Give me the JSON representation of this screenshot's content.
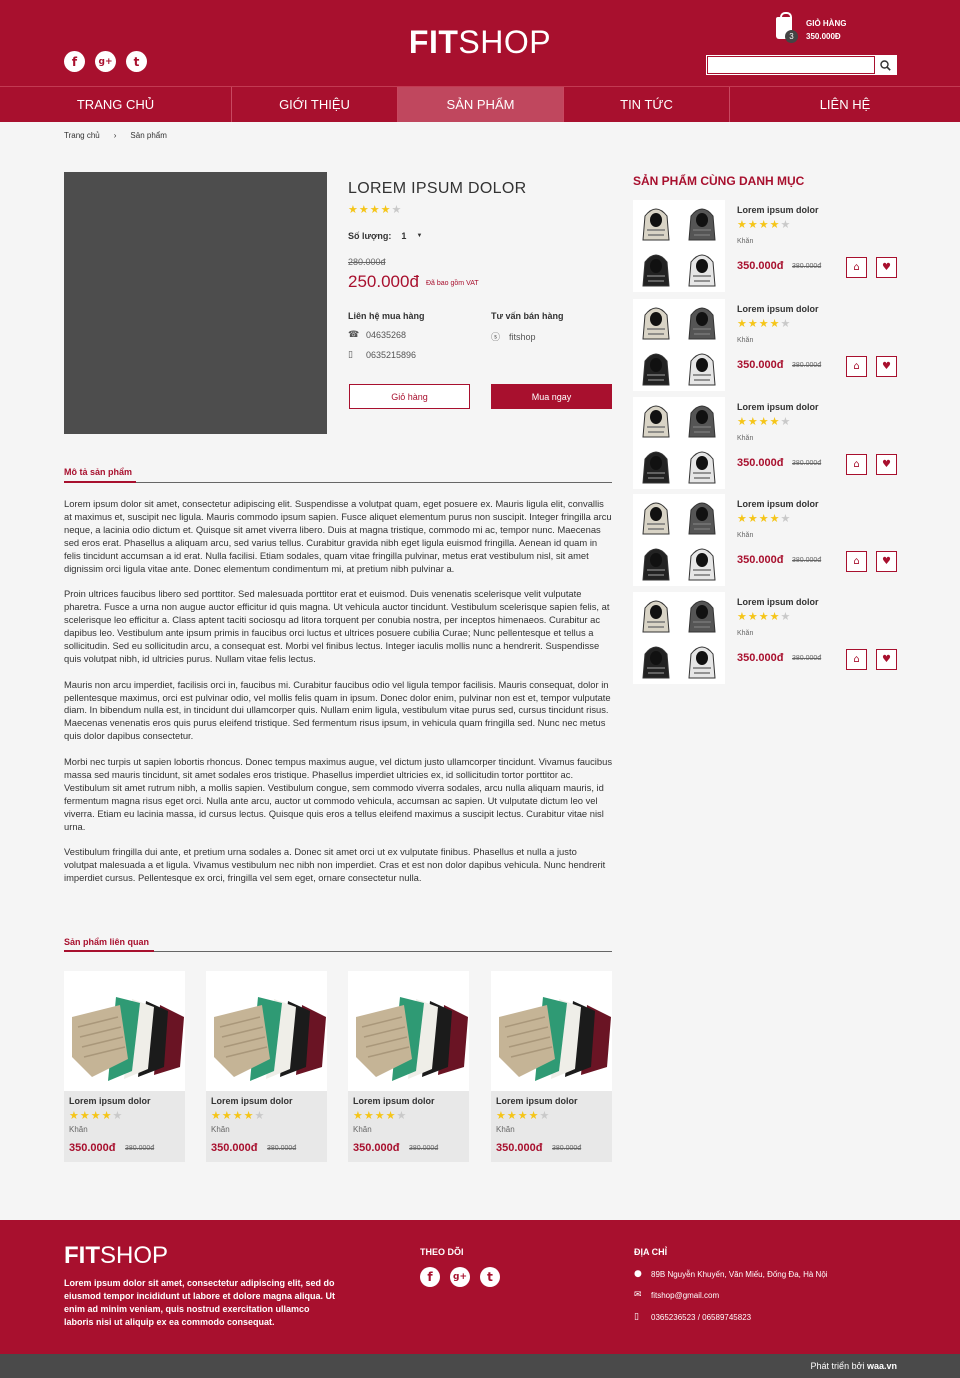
{
  "header": {
    "logo_bold": "FIT",
    "logo_light": "SHOP",
    "cart_label": "GIỎ HÀNG",
    "cart_amount": "350.000Đ",
    "cart_count": "3",
    "search_placeholder": ""
  },
  "nav": {
    "items": [
      {
        "label": "TRANG CHỦ"
      },
      {
        "label": "GIỚI THIỆU"
      },
      {
        "label": "SẢN PHẨM"
      },
      {
        "label": "TIN TỨC"
      },
      {
        "label": "LIÊN HỆ"
      }
    ],
    "active_index": 2
  },
  "breadcrumb": [
    "Trang chủ",
    "›",
    "Sản phẩm"
  ],
  "product": {
    "title": "LOREM IPSUM DOLOR",
    "rating": 4,
    "qty_label": "Số lượng:",
    "qty_value": "1",
    "old_price": "280.000đ",
    "new_price": "250.000đ",
    "vat_note": "Đã bao gồm VAT",
    "contact_heading": "Liên hệ mua hàng",
    "phone1": "04635268",
    "phone2": "0635215896",
    "consult_heading": "Tư vấn bán hàng",
    "skype": "fitshop",
    "cart_button": "Giỏ hàng",
    "buy_button": "Mua ngay"
  },
  "description": {
    "heading": "Mô tả sản phẩm",
    "paragraphs": [
      "Lorem ipsum dolor sit amet, consectetur adipiscing elit. Suspendisse a volutpat quam, eget posuere ex. Mauris ligula elit, convallis at maximus et, suscipit nec ligula. Mauris commodo ipsum sapien. Fusce aliquet elementum purus non suscipit. Integer fringilla arcu neque, a lacinia odio dictum et. Quisque sit amet viverra libero. Duis at magna tristique, commodo mi ac, tempor nunc. Maecenas sed eros erat. Phasellus a aliquam arcu, sed varius tellus. Curabitur gravida nibh eget ligula euismod fringilla. Aenean id quam in felis tincidunt accumsan a id erat. Nulla facilisi. Etiam sodales, quam vitae fringilla pulvinar, metus erat vestibulum nisl, sit amet dignissim orci ligula vitae ante. Donec elementum condimentum mi, at pretium nibh pulvinar a.",
      "Proin ultrices faucibus libero sed porttitor. Sed malesuada porttitor erat et euismod. Duis venenatis scelerisque velit vulputate pharetra. Fusce a urna non augue auctor efficitur id quis magna. Ut vehicula auctor tincidunt. Vestibulum scelerisque sapien felis, at scelerisque leo efficitur a. Class aptent taciti sociosqu ad litora torquent per conubia nostra, per inceptos himenaeos. Curabitur ac dapibus leo. Vestibulum ante ipsum primis in faucibus orci luctus et ultrices posuere cubilia Curae; Nunc pellentesque et tellus a sollicitudin. Sed eu sollicitudin arcu, a consequat est. Morbi vel finibus lectus. Integer iaculis mollis nunc a hendrerit. Suspendisse quis volutpat nibh, id ultricies purus. Nullam vitae felis lectus.",
      "Mauris non arcu imperdiet, facilisis orci in, faucibus mi. Curabitur faucibus odio vel ligula tempor facilisis. Mauris consequat, dolor in pellentesque maximus, orci est pulvinar odio, vel mollis felis quam in ipsum. Donec dolor enim, pulvinar non est et, tempor vulputate diam. In bibendum nulla est, in tincidunt dui ullamcorper quis. Nullam enim ligula, vestibulum vitae purus sed, cursus tincidunt risus. Maecenas venenatis eros quis purus eleifend tristique. Sed fermentum risus ipsum, in vehicula quam fringilla sed. Nunc nec metus quis dolor dapibus consectetur.",
      "Morbi nec turpis ut sapien lobortis rhoncus. Donec tempus maximus augue, vel dictum justo ullamcorper tincidunt. Vivamus faucibus massa sed mauris tincidunt, sit amet sodales eros tristique. Phasellus imperdiet ultricies ex, id sollicitudin tortor porttitor ac. Vestibulum sit amet rutrum nibh, a mollis sapien. Vestibulum congue, sem commodo viverra sodales, arcu nulla aliquam mauris, id fermentum magna risus eget orci. Nulla ante arcu, auctor ut commodo vehicula, accumsan ac sapien. Ut vulputate dictum leo vel viverra. Etiam eu lacinia massa, id cursus lectus. Quisque quis eros a tellus eleifend maximus a suscipit lectus. Curabitur vitae nisl urna.",
      "Vestibulum fringilla dui ante, et pretium urna sodales a. Donec sit amet orci ut ex vulputate finibus. Phasellus et nulla a justo volutpat malesuada a et ligula. Vivamus vestibulum nec nibh non imperdiet. Cras et est non dolor dapibus vehicula. Nunc hendrerit imperdiet cursus. Pellentesque ex orci, fringilla vel sem eget, ornare consectetur nulla."
    ]
  },
  "related": {
    "heading": "Sản phẩm liên quan",
    "items": [
      {
        "name": "Lorem ipsum dolor",
        "rating": 4,
        "category": "Khăn",
        "price": "350.000đ",
        "old_price": "380.000đ"
      },
      {
        "name": "Lorem ipsum dolor",
        "rating": 4,
        "category": "Khăn",
        "price": "350.000đ",
        "old_price": "380.000đ"
      },
      {
        "name": "Lorem ipsum dolor",
        "rating": 4,
        "category": "Khăn",
        "price": "350.000đ",
        "old_price": "380.000đ"
      },
      {
        "name": "Lorem ipsum dolor",
        "rating": 4,
        "category": "Khăn",
        "price": "350.000đ",
        "old_price": "380.000đ"
      }
    ]
  },
  "same_category": {
    "heading": "SẢN PHẨM CÙNG DANH MỤC",
    "items": [
      {
        "name": "Lorem ipsum dolor",
        "rating": 4,
        "category": "Khăn",
        "price": "350.000đ",
        "old_price": "380.000đ"
      },
      {
        "name": "Lorem ipsum dolor",
        "rating": 4,
        "category": "Khăn",
        "price": "350.000đ",
        "old_price": "380.000đ"
      },
      {
        "name": "Lorem ipsum dolor",
        "rating": 4,
        "category": "Khăn",
        "price": "350.000đ",
        "old_price": "380.000đ"
      },
      {
        "name": "Lorem ipsum dolor",
        "rating": 4,
        "category": "Khăn",
        "price": "350.000đ",
        "old_price": "380.000đ"
      },
      {
        "name": "Lorem ipsum dolor",
        "rating": 4,
        "category": "Khăn",
        "price": "350.000đ",
        "old_price": "380.000đ"
      }
    ]
  },
  "footer": {
    "logo_bold": "FIT",
    "logo_light": "SHOP",
    "about": "Lorem ipsum dolor sit amet, consectetur adipiscing elit, sed do eiusmod tempor incididunt ut labore et dolore magna aliqua. Ut enim ad minim veniam, quis nostrud exercitation ullamco laboris nisi ut aliquip ex ea commodo consequat.",
    "follow_heading": "THEO DÕI",
    "address_heading": "ĐỊA CHỈ",
    "address": "89B Nguyễn Khuyến, Văn Miếu, Đống Đa, Hà Nội",
    "email": "fitshop@gmail.com",
    "phones": "0365236523 / 06589745823",
    "credit_prefix": "Phát triển bởi ",
    "credit_brand": "waa.vn"
  },
  "colors": {
    "brand": "#a8102e",
    "star": "#f5c518",
    "footer_bar": "#4a4a4a"
  },
  "icons": {
    "social": [
      "facebook-icon",
      "google-plus-icon",
      "twitter-icon"
    ],
    "cart": "shopping-bag-icon",
    "search": "search-icon"
  }
}
